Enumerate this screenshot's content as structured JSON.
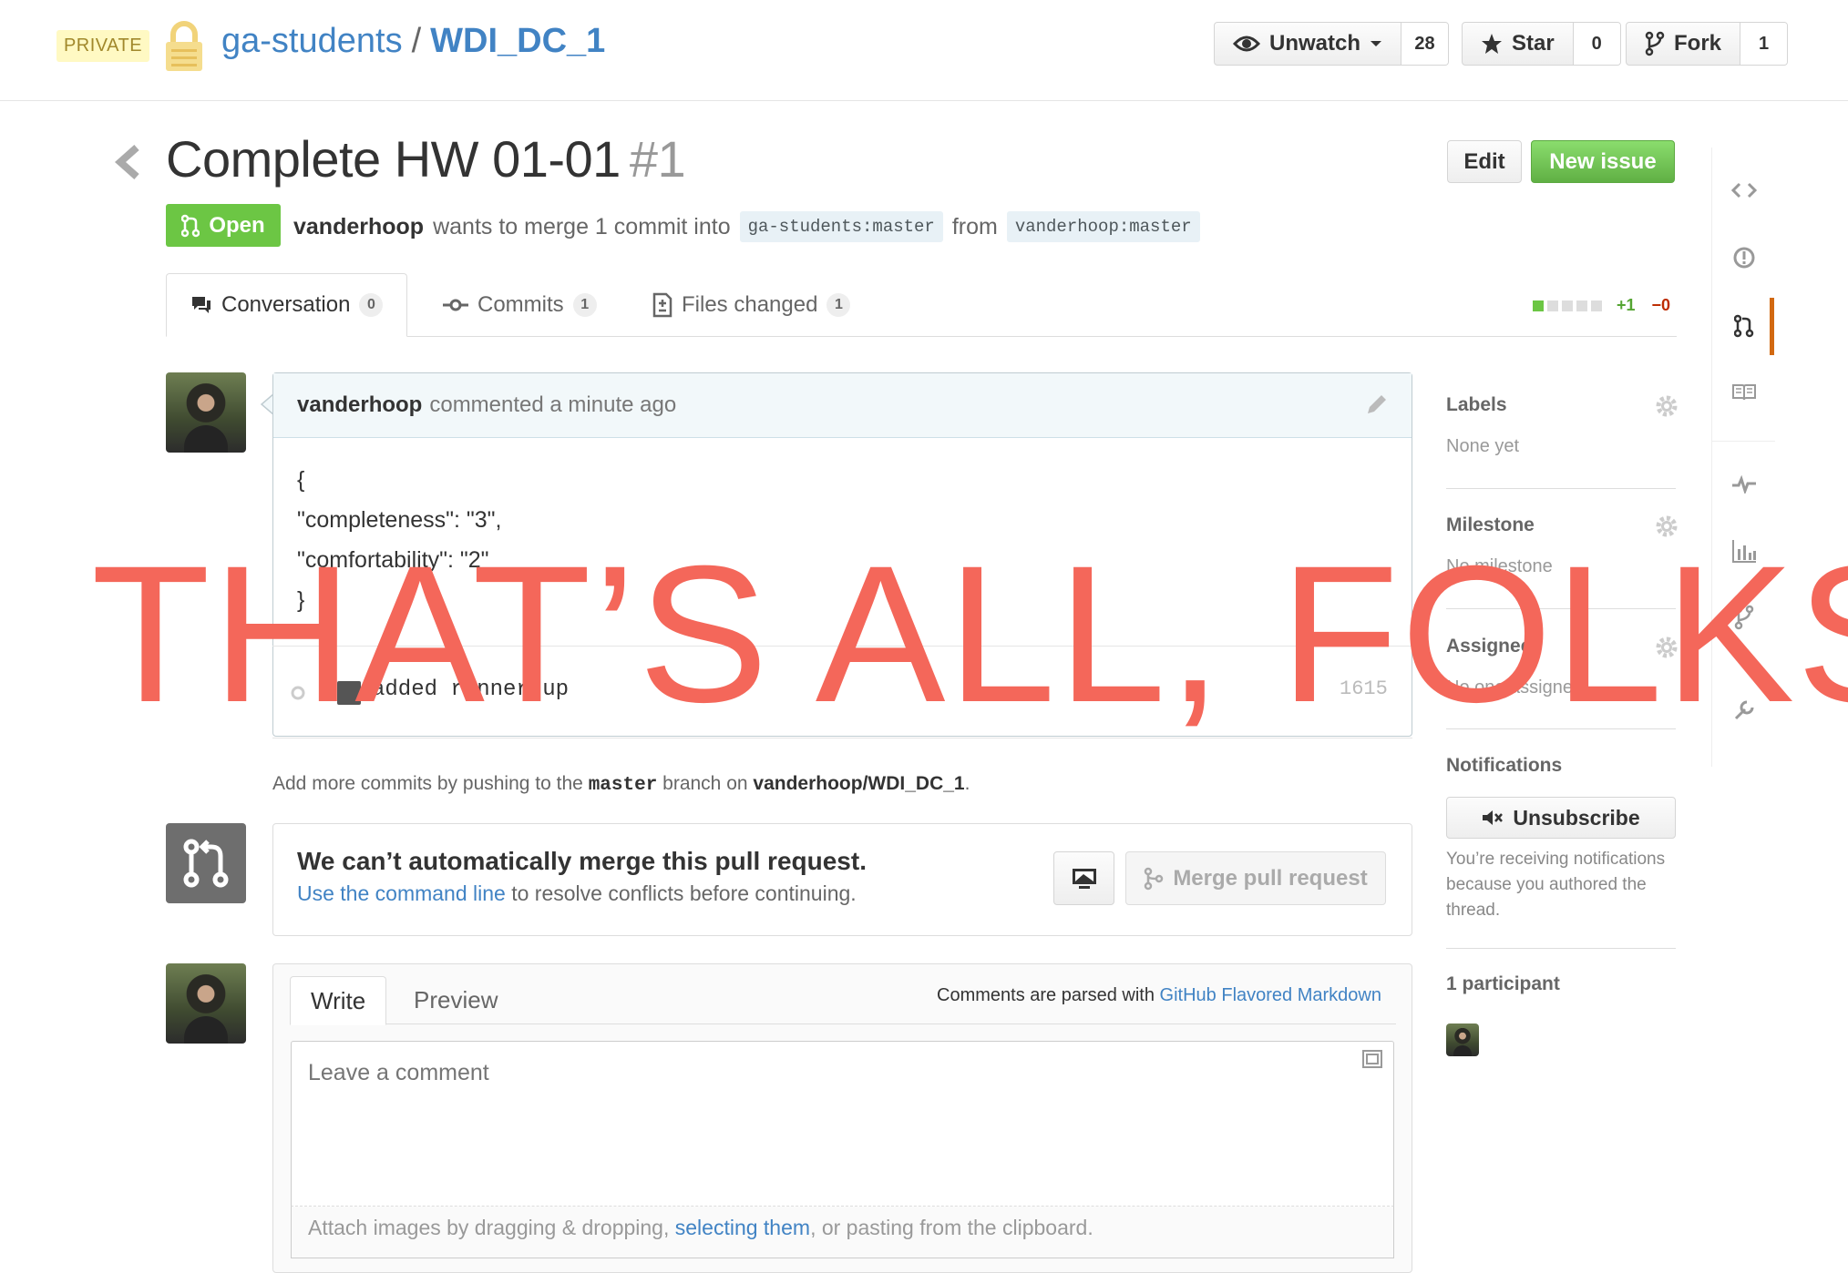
{
  "repo": {
    "visibility": "PRIVATE",
    "owner": "ga-students",
    "separator": "/",
    "name": "WDI_DC_1"
  },
  "repo_actions": {
    "watch_label": "Unwatch",
    "watch_count": "28",
    "star_label": "Star",
    "star_count": "0",
    "fork_label": "Fork",
    "fork_count": "1"
  },
  "issue": {
    "title": "Complete HW 01-01",
    "number": "#1",
    "state": "Open",
    "author": "vanderhoop",
    "merge_text": "wants to merge 1 commit into",
    "base_branch": "ga-students:master",
    "from_text": "from",
    "head_branch": "vanderhoop:master",
    "edit_label": "Edit",
    "new_issue_label": "New issue"
  },
  "tabs": [
    {
      "label": "Conversation",
      "count": "0"
    },
    {
      "label": "Commits",
      "count": "1"
    },
    {
      "label": "Files changed",
      "count": "1"
    }
  ],
  "diffstat": {
    "additions": "+1",
    "deletions": "−0"
  },
  "comment": {
    "author": "vanderhoop",
    "meta": "commented a minute ago",
    "body_lines": [
      "{",
      "\"completeness\": \"3\",",
      "\"comfortability\": \"2\"",
      "}"
    ]
  },
  "commit": {
    "message": "added runner up",
    "sha": "1615"
  },
  "push_note": {
    "prefix": "Add more commits by pushing to the",
    "branch": "master",
    "middle": "branch on",
    "repo": "vanderhoop/WDI_DC_1",
    "suffix": "."
  },
  "merge": {
    "title": "We can’t automatically merge this pull request.",
    "link_text": "Use the command line",
    "sub_text": "to resolve conflicts before continuing.",
    "button_label": "Merge pull request"
  },
  "form": {
    "write_tab": "Write",
    "preview_tab": "Preview",
    "md_prefix": "Comments are parsed with",
    "md_link": "GitHub Flavored Markdown",
    "placeholder": "Leave a comment",
    "drop_prefix": "Attach images by dragging & dropping,",
    "drop_link": "selecting them",
    "drop_suffix": ", or pasting from the clipboard."
  },
  "sidebar": {
    "labels_heading": "Labels",
    "labels_value": "None yet",
    "milestone_heading": "Milestone",
    "milestone_value": "No milestone",
    "assignee_heading": "Assignee",
    "assignee_value": "No one assigned",
    "notifications_heading": "Notifications",
    "unsubscribe_label": "Unsubscribe",
    "notifications_reason": "You’re receiving notifications because you authored the thread.",
    "participants_heading": "1 participant"
  },
  "overlay": {
    "text": "THAT’S ALL, FOLKS"
  },
  "colors": {
    "link": "#4183c4",
    "open_green": "#6cc644",
    "overlay_red": "#f4675a",
    "active_nav": "#d26911"
  },
  "icons": [
    "lock-icon",
    "eye-icon",
    "star-icon",
    "fork-icon",
    "chevron-left-icon",
    "pull-request-icon",
    "comment-icon",
    "commit-icon",
    "file-diff-icon",
    "pencil-icon",
    "monitor-icon",
    "branch-icon",
    "gear-icon",
    "mute-icon",
    "fullscreen-icon",
    "code-icon",
    "issue-icon",
    "wiki-icon",
    "pulse-icon",
    "graph-icon",
    "network-icon",
    "settings-icon"
  ]
}
